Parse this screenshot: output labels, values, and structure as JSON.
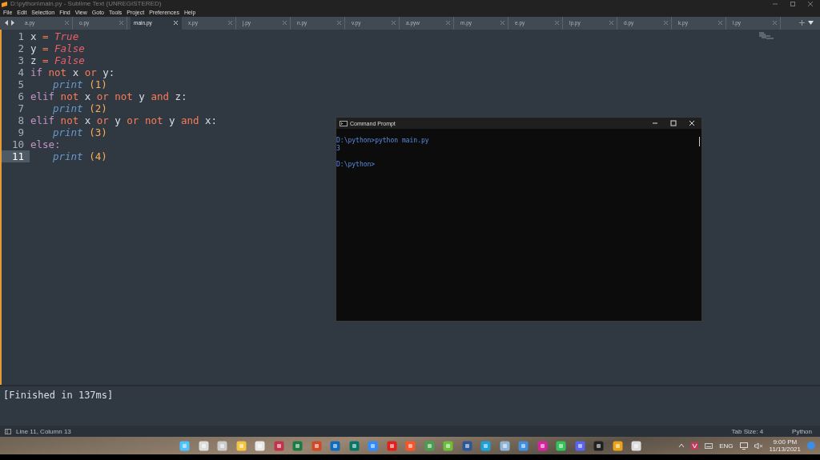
{
  "window": {
    "title": "D:\\python\\main.py - Sublime Text (UNREGISTERED)"
  },
  "menu": [
    "File",
    "Edit",
    "Selection",
    "Find",
    "View",
    "Goto",
    "Tools",
    "Project",
    "Preferences",
    "Help"
  ],
  "tabs": [
    {
      "label": "a.py",
      "selected": false
    },
    {
      "label": "o.py",
      "selected": false
    },
    {
      "label": "main.py",
      "selected": true
    },
    {
      "label": "x.py",
      "selected": false
    },
    {
      "label": "j.py",
      "selected": false
    },
    {
      "label": "n.py",
      "selected": false
    },
    {
      "label": "v.py",
      "selected": false
    },
    {
      "label": "a.pyw",
      "selected": false
    },
    {
      "label": "m.py",
      "selected": false
    },
    {
      "label": "e.py",
      "selected": false
    },
    {
      "label": "lp.py",
      "selected": false
    },
    {
      "label": "d.py",
      "selected": false
    },
    {
      "label": "k.py",
      "selected": false
    },
    {
      "label": "l.py",
      "selected": false
    }
  ],
  "code": [
    {
      "number": "1",
      "current": false,
      "indent": false,
      "tokens": [
        {
          "text": "x",
          "kind": "name"
        },
        {
          "text": "=",
          "kind": "op"
        },
        {
          "text": "True",
          "kind": "const"
        }
      ]
    },
    {
      "number": "2",
      "current": false,
      "indent": false,
      "tokens": [
        {
          "text": "y",
          "kind": "name"
        },
        {
          "text": "=",
          "kind": "op"
        },
        {
          "text": "False",
          "kind": "const"
        }
      ]
    },
    {
      "number": "3",
      "current": false,
      "indent": false,
      "tokens": [
        {
          "text": "z",
          "kind": "name"
        },
        {
          "text": "=",
          "kind": "op"
        },
        {
          "text": "False",
          "kind": "const"
        }
      ]
    },
    {
      "number": "4",
      "current": false,
      "indent": false,
      "tokens": [
        {
          "text": "if",
          "kind": "keyword"
        },
        {
          "text": "not",
          "kind": "op"
        },
        {
          "text": "x",
          "kind": "name"
        },
        {
          "text": "or",
          "kind": "op"
        },
        {
          "text": "y:",
          "kind": "name"
        }
      ]
    },
    {
      "number": "5",
      "current": false,
      "indent": true,
      "tokens": [
        {
          "text": "print",
          "kind": "func"
        },
        {
          "text": "(1)",
          "kind": "call"
        }
      ]
    },
    {
      "number": "6",
      "current": false,
      "indent": false,
      "tokens": [
        {
          "text": "elif",
          "kind": "keyword"
        },
        {
          "text": "not",
          "kind": "op"
        },
        {
          "text": "x",
          "kind": "name"
        },
        {
          "text": "or",
          "kind": "op"
        },
        {
          "text": "not",
          "kind": "op"
        },
        {
          "text": "y",
          "kind": "name"
        },
        {
          "text": "and",
          "kind": "op"
        },
        {
          "text": "z:",
          "kind": "name"
        }
      ]
    },
    {
      "number": "7",
      "current": false,
      "indent": true,
      "tokens": [
        {
          "text": "print",
          "kind": "func"
        },
        {
          "text": "(2)",
          "kind": "call"
        }
      ]
    },
    {
      "number": "8",
      "current": false,
      "indent": false,
      "tokens": [
        {
          "text": "elif",
          "kind": "keyword"
        },
        {
          "text": "not",
          "kind": "op"
        },
        {
          "text": "x",
          "kind": "name"
        },
        {
          "text": "or",
          "kind": "op"
        },
        {
          "text": "y",
          "kind": "name"
        },
        {
          "text": "or",
          "kind": "op"
        },
        {
          "text": "not",
          "kind": "op"
        },
        {
          "text": "y",
          "kind": "name"
        },
        {
          "text": "and",
          "kind": "op"
        },
        {
          "text": "x:",
          "kind": "name"
        }
      ]
    },
    {
      "number": "9",
      "current": false,
      "indent": true,
      "tokens": [
        {
          "text": "print",
          "kind": "func"
        },
        {
          "text": "(3)",
          "kind": "call"
        }
      ]
    },
    {
      "number": "10",
      "current": false,
      "indent": false,
      "tokens": [
        {
          "text": "else:",
          "kind": "keyword"
        }
      ]
    },
    {
      "number": "11",
      "current": true,
      "indent": true,
      "tokens": [
        {
          "text": "print",
          "kind": "func"
        },
        {
          "text": "(4)",
          "kind": "call"
        }
      ]
    }
  ],
  "output": "[Finished in 137ms]",
  "status_bar": {
    "position": "Line 11, Column 13",
    "tab_size": "Tab Size: 4",
    "syntax": "Python"
  },
  "console": {
    "title": "Command Prompt",
    "blocks": [
      [
        "D:\\python>python main.py",
        "3"
      ],
      [
        "D:\\python>"
      ]
    ]
  },
  "tray": {
    "language": "ENG",
    "time": "9:00 PM",
    "date": "11/13/2021"
  }
}
